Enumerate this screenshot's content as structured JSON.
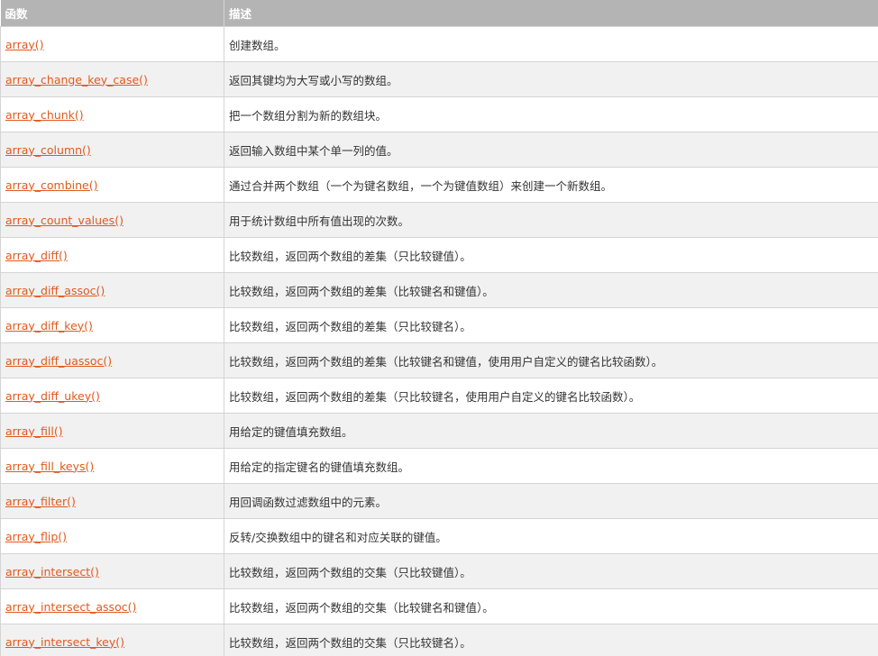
{
  "table": {
    "headers": [
      "函数",
      "描述"
    ],
    "rows": [
      {
        "fn": "array()",
        "desc": "创建数组。"
      },
      {
        "fn": "array_change_key_case()",
        "desc": "返回其键均为大写或小写的数组。"
      },
      {
        "fn": "array_chunk()",
        "desc": "把一个数组分割为新的数组块。"
      },
      {
        "fn": "array_column()",
        "desc": "返回输入数组中某个单一列的值。"
      },
      {
        "fn": "array_combine()",
        "desc": "通过合并两个数组（一个为键名数组，一个为键值数组）来创建一个新数组。"
      },
      {
        "fn": "array_count_values()",
        "desc": "用于统计数组中所有值出现的次数。"
      },
      {
        "fn": "array_diff()",
        "desc": "比较数组，返回两个数组的差集（只比较键值）。"
      },
      {
        "fn": "array_diff_assoc()",
        "desc": "比较数组，返回两个数组的差集（比较键名和键值）。"
      },
      {
        "fn": "array_diff_key()",
        "desc": "比较数组，返回两个数组的差集（只比较键名）。"
      },
      {
        "fn": "array_diff_uassoc()",
        "desc": "比较数组，返回两个数组的差集（比较键名和键值，使用用户自定义的键名比较函数）。"
      },
      {
        "fn": "array_diff_ukey()",
        "desc": "比较数组，返回两个数组的差集（只比较键名，使用用户自定义的键名比较函数）。"
      },
      {
        "fn": "array_fill()",
        "desc": "用给定的键值填充数组。"
      },
      {
        "fn": "array_fill_keys()",
        "desc": "用给定的指定键名的键值填充数组。"
      },
      {
        "fn": "array_filter()",
        "desc": "用回调函数过滤数组中的元素。"
      },
      {
        "fn": "array_flip()",
        "desc": "反转/交换数组中的键名和对应关联的键值。"
      },
      {
        "fn": "array_intersect()",
        "desc": "比较数组，返回两个数组的交集（只比较键值）。"
      },
      {
        "fn": "array_intersect_assoc()",
        "desc": "比较数组，返回两个数组的交集（比较键名和键值）。"
      },
      {
        "fn": "array_intersect_key()",
        "desc": "比较数组，返回两个数组的交集（只比较键名）。"
      }
    ]
  },
  "colors": {
    "header_bg": "#b4b4b4",
    "link": "#e1591e",
    "zebra": "#f1f1f1",
    "border": "#d4d4d4"
  }
}
